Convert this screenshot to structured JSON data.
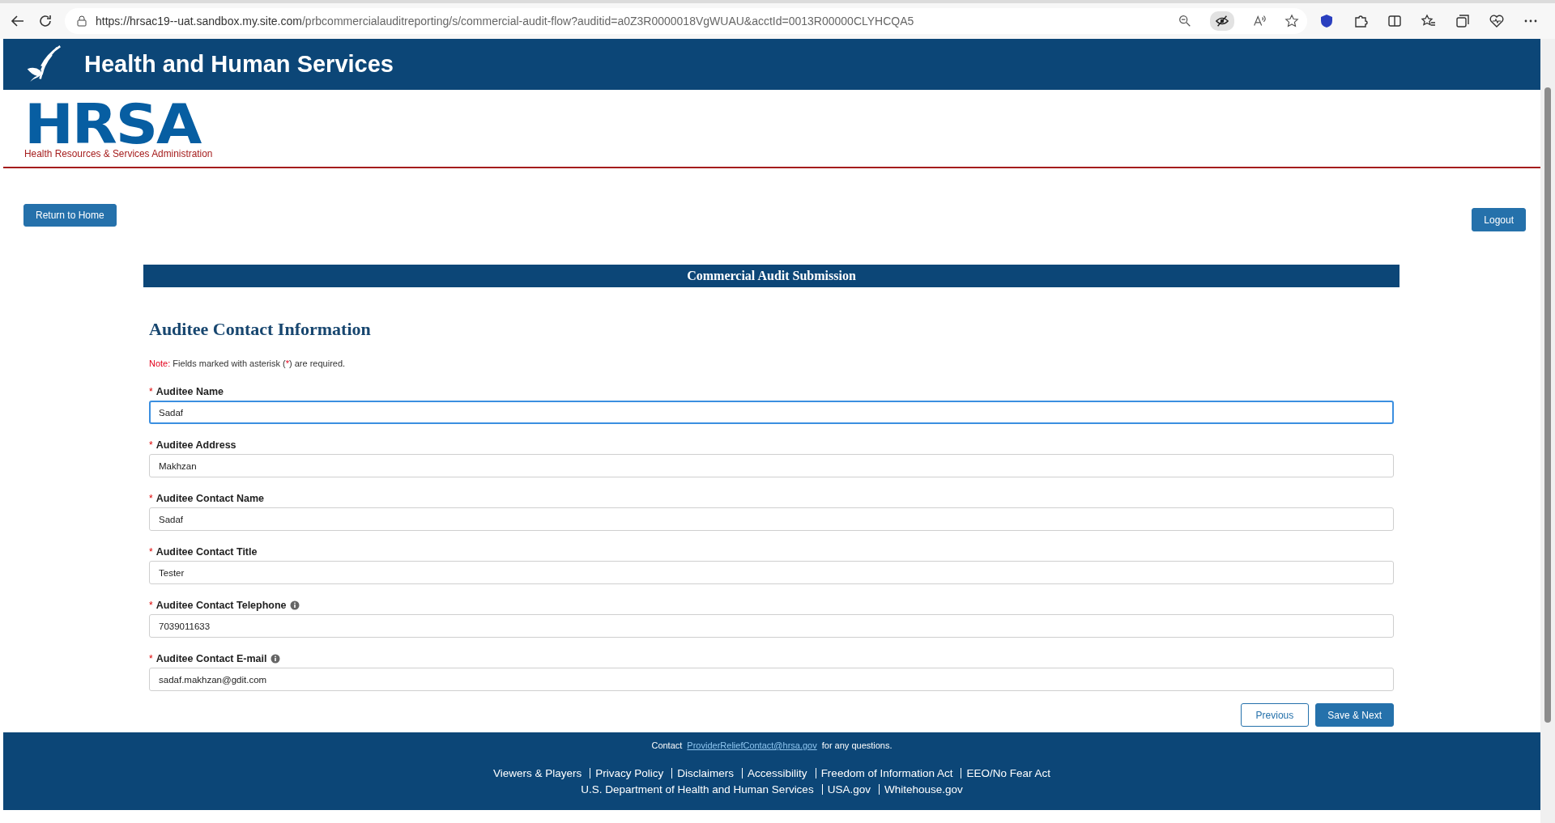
{
  "browser": {
    "url_host": "https://hrsac19--uat.sandbox.my.site.com",
    "url_path": "/prbcommercialauditreporting/s/commercial-audit-flow?auditid=a0Z3R0000018VgWUAU&acctId=0013R00000CLYHCQA5"
  },
  "header": {
    "title": "Health and Human Services",
    "logo": "HRSA",
    "logo_subtitle": "Health Resources & Services Administration"
  },
  "nav": {
    "home_button": "Return to Home",
    "logout_button": "Logout"
  },
  "form": {
    "banner": "Commercial Audit Submission",
    "heading": "Auditee Contact Information",
    "note_label": "Note:",
    "note_text_before": "Fields marked with asterisk (",
    "note_mark": "*",
    "note_text_after": ") are required.",
    "fields": [
      {
        "required": true,
        "label": "Auditee Name",
        "value": "Sadaf",
        "info": false,
        "focused": true
      },
      {
        "required": true,
        "label": "Auditee Address",
        "value": "Makhzan",
        "info": false,
        "focused": false
      },
      {
        "required": true,
        "label": "Auditee Contact Name",
        "value": "Sadaf",
        "info": false,
        "focused": false
      },
      {
        "required": true,
        "label": "Auditee Contact Title",
        "value": "Tester",
        "info": false,
        "focused": false
      },
      {
        "required": true,
        "label": "Auditee Contact Telephone",
        "value": "7039011633",
        "info": true,
        "focused": false
      },
      {
        "required": true,
        "label": "Auditee Contact E-mail",
        "value": "sadaf.makhzan@gdit.com",
        "info": true,
        "focused": false
      }
    ],
    "buttons": {
      "previous": "Previous",
      "next": "Save & Next"
    }
  },
  "footer": {
    "contact_before": "Contact",
    "contact_link": "ProviderReliefContact@hrsa.gov",
    "contact_after": "for any questions.",
    "link_rows": [
      [
        "Viewers & Players",
        "Privacy Policy",
        "Disclaimers",
        "Accessibility",
        "Freedom of Information Act",
        "EEO/No Fear Act"
      ],
      [
        "U.S. Department of Health and Human Services",
        "USA.gov",
        "Whitehouse.gov"
      ]
    ]
  }
}
